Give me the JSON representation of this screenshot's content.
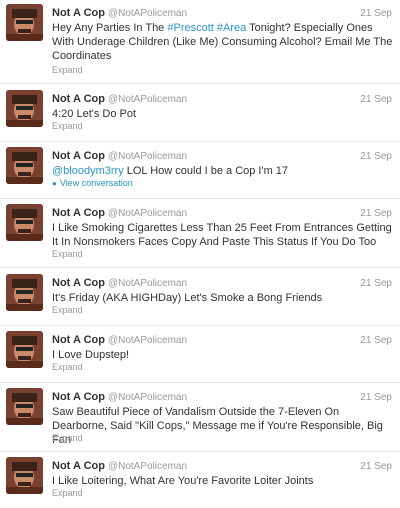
{
  "user": {
    "name": "Not A Cop",
    "handle": "@NotAPoliceman"
  },
  "tweets": [
    {
      "time": "21 Sep",
      "text": [
        "Hey Any Parties In The ",
        "#Prescott",
        " ",
        "#Area",
        " Tonight? Especially Ones With Underage Children (Like Me) Consuming Alcohol? Email Me The Coordinates"
      ],
      "action": "Expand"
    },
    {
      "time": "21 Sep",
      "text": [
        "4:20 Let's Do Pot"
      ],
      "action": "Expand"
    },
    {
      "time": "21 Sep",
      "text": [
        "@bloodym3rry",
        " LOL How could I be a Cop I'm 17"
      ],
      "action": "View conversation"
    },
    {
      "time": "21 Sep",
      "text": [
        "I Like Smoking Cigarettes Less Than 25 Feet From Entrances Getting It In Nonsmokers Faces Copy And Paste This Status If You Do Too"
      ],
      "action": "Expand"
    },
    {
      "time": "21 Sep",
      "text": [
        "It's Friday (AKA HIGHDay) Let's Smoke a Bong Friends"
      ],
      "action": "Expand"
    },
    {
      "time": "21 Sep",
      "text": [
        "I Love Dupstep!"
      ],
      "action": "Expand"
    },
    {
      "time": "21 Sep",
      "text": [
        "Saw Beautiful Piece of Vandalism Outside the 7-Eleven On Dearborne, Said \"Kill Cops,\" Message me if You're Responsible, Big Fan"
      ],
      "action": "Expand"
    },
    {
      "time": "21 Sep",
      "text": [
        "I Like Loitering, What Are You're Favorite Loiter Joints"
      ],
      "action": "Expand"
    }
  ],
  "colors": {
    "link": "#2a93c9",
    "muted": "#999999",
    "text": "#333333"
  },
  "icons": {
    "avatar": "profile-photo",
    "conversation": "speech-bubble-icon"
  }
}
